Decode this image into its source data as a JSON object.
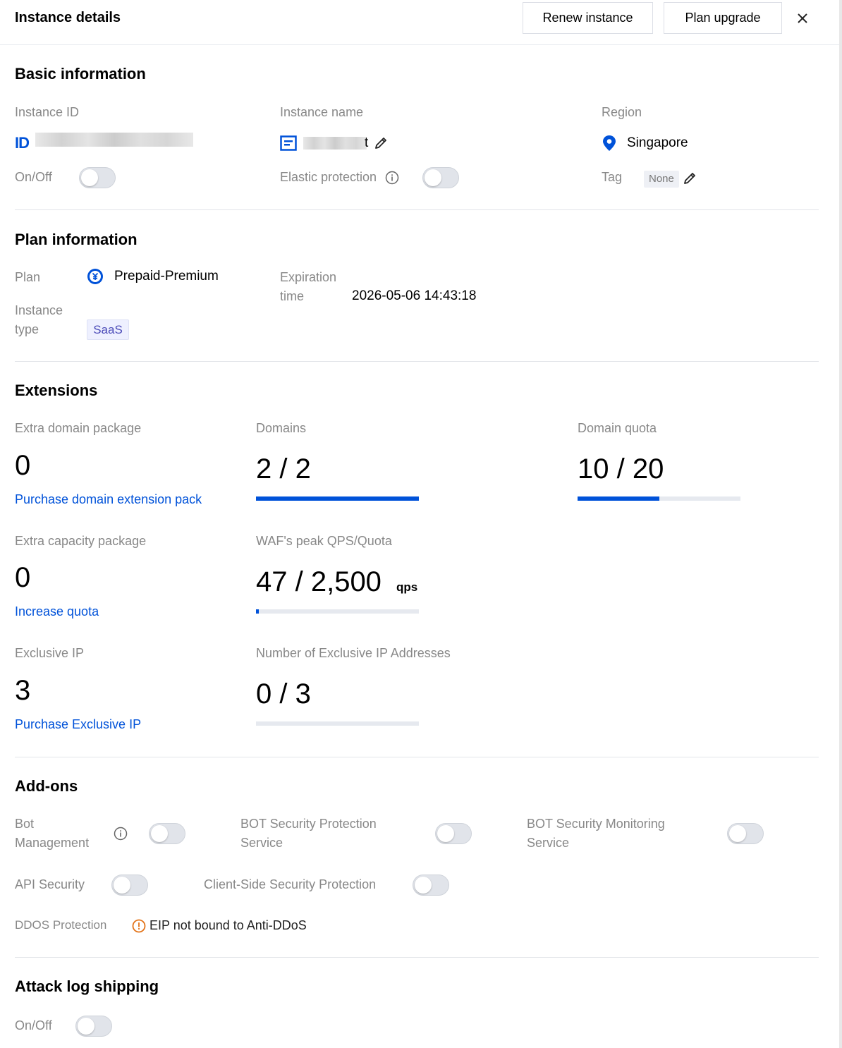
{
  "header": {
    "title": "Instance details",
    "renew_label": "Renew instance",
    "upgrade_label": "Plan upgrade"
  },
  "basic": {
    "title": "Basic information",
    "instance_id_label": "Instance ID",
    "instance_id_prefix": "ID",
    "instance_name_label": "Instance name",
    "instance_name_suffix": "t",
    "region_label": "Region",
    "region_value": "Singapore",
    "onoff_label": "On/Off",
    "elastic_label": "Elastic protection",
    "tag_label": "Tag",
    "tag_value": "None"
  },
  "plan": {
    "title": "Plan information",
    "plan_label": "Plan",
    "plan_value": "Prepaid-Premium",
    "instance_type_label_1": "Instance",
    "instance_type_label_2": "type",
    "instance_type_value": "SaaS",
    "expiration_label_1": "Expiration",
    "expiration_label_2": "time",
    "expiration_value": "2026-05-06 14:43:18"
  },
  "extensions": {
    "title": "Extensions",
    "extra_domain_label": "Extra domain package",
    "extra_domain_value": "0",
    "purchase_domain_link": "Purchase domain extension pack",
    "domains_label": "Domains",
    "domains_value": "2 / 2",
    "domains_fraction": 1.0,
    "domain_quota_label": "Domain quota",
    "domain_quota_value": "10 / 20",
    "domain_quota_fraction": 0.5,
    "extra_capacity_label": "Extra capacity package",
    "extra_capacity_value": "0",
    "increase_quota_link": "Increase quota",
    "qps_label": "WAF's peak QPS/Quota",
    "qps_value": "47 / 2,500",
    "qps_unit": "qps",
    "qps_fraction": 0.0188,
    "exclusive_ip_label": "Exclusive IP",
    "exclusive_ip_value": "3",
    "purchase_ip_link": "Purchase Exclusive IP",
    "num_ip_label": "Number of Exclusive IP Addresses",
    "num_ip_value": "0 / 3",
    "num_ip_fraction": 0
  },
  "addons": {
    "title": "Add-ons",
    "bot_mgmt_label_1": "Bot",
    "bot_mgmt_label_2": "Management",
    "bot_protect_label_1": "BOT Security Protection",
    "bot_protect_label_2": "Service",
    "bot_monitor_label_1": "BOT Security Monitoring",
    "bot_monitor_label_2": "Service",
    "api_security_label": "API Security",
    "client_side_label": "Client-Side Security Protection",
    "ddos_label": "DDOS Protection",
    "ddos_status": "EIP not bound to Anti-DDoS"
  },
  "attack_log": {
    "title": "Attack log shipping",
    "onoff_label": "On/Off"
  },
  "colors": {
    "accent": "#0052d9",
    "warning": "#e37318",
    "tag_bg": "#eef0f5",
    "saas_bg": "#eef0ff",
    "saas_text": "#4a4ab8"
  }
}
